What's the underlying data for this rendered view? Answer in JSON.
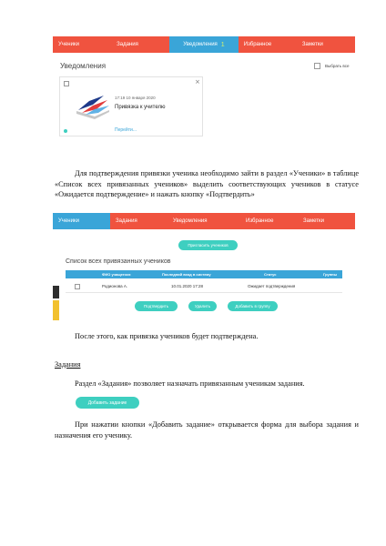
{
  "screen1": {
    "tabs": [
      "Ученики",
      "Задания",
      "Уведомления",
      "Избранное",
      "Заметки"
    ],
    "active_badge": "1",
    "section_title": "Уведомления",
    "select_all": "Выбрать все",
    "card": {
      "date": "17:19 10 января 2020",
      "title": "Привязка к учителю",
      "link": "Перейти..."
    }
  },
  "paragraph1": "Для подтверждения привязки ученика необходимо  зайти в раздел «Ученики» в таблице «Список всех привязанных учеников» выделить соответствующих учеников в статусе «Ожидается подтверждение» и нажать кнопку «Подтвердить»",
  "screen2": {
    "tabs": [
      "Ученики",
      "Задания",
      "Уведомления",
      "Избранное",
      "Заметки"
    ],
    "invite_button": "Пригласить учеников",
    "list_title": "Список всех привязанных учеников",
    "columns": [
      "ФИО учащегося",
      "Последний вход в систему",
      "Статус",
      "Группы"
    ],
    "row": {
      "name": "Родионова А.",
      "last_login": "10.01.2020 17:28",
      "status": "Ожидает подтверждения",
      "group": ""
    },
    "actions": [
      "Подтвердить",
      "Удалить",
      "Добавить в группу"
    ]
  },
  "paragraph2": "После этого, как привязка учеников будет подтверждена.",
  "section_heading": "Задания",
  "paragraph3": "Раздел «Задания» позволяет назначать привязанным ученикам задания.",
  "add_task_button": "Добавить задание",
  "paragraph4": "При нажатии кнопки «Добавить задание» открывается форма для выбора задания и назначения его ученику."
}
